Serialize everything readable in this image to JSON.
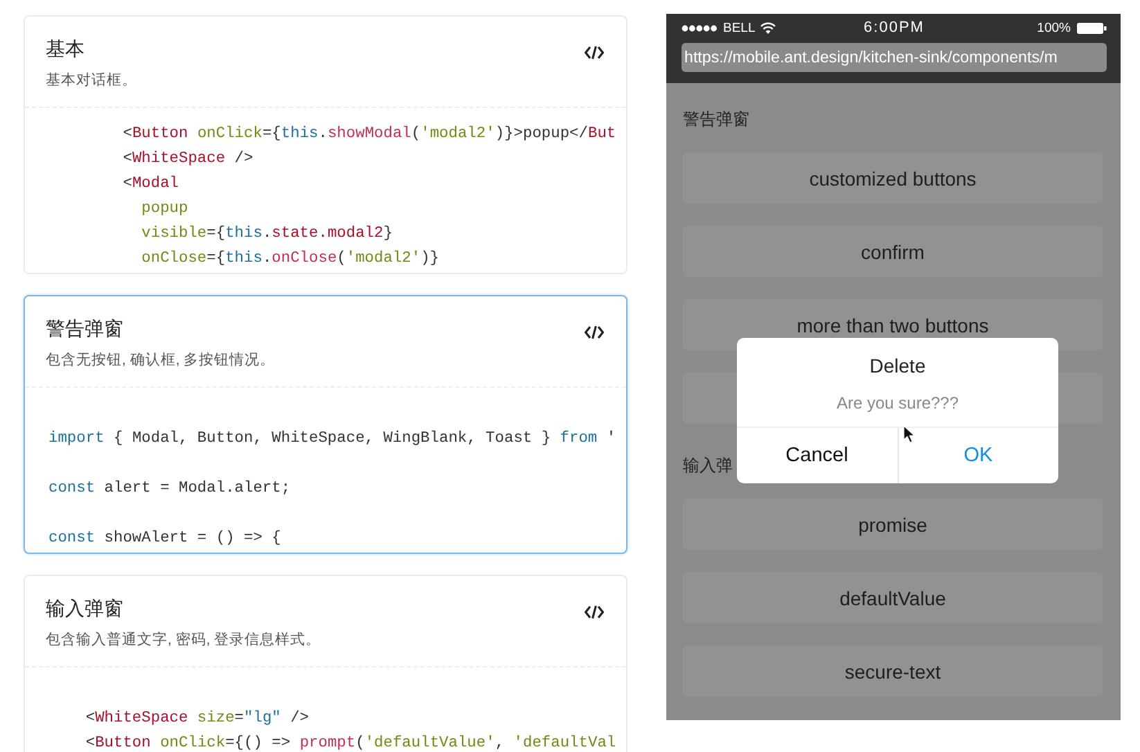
{
  "demo_cards": [
    {
      "title": "基本",
      "description": "基本对话框。",
      "selected": false,
      "code_lines": [
        {
          "kind": "code",
          "tokens": [
            {
              "kind": "punct",
              "text": "        <"
            },
            {
              "kind": "tag",
              "text": "Button"
            },
            {
              "kind": "attr",
              "text": " onClick"
            },
            {
              "kind": "punct",
              "text": "={"
            },
            {
              "kind": "keyword",
              "text": "this"
            },
            {
              "kind": "punct",
              "text": "."
            },
            {
              "kind": "func",
              "text": "showModal"
            },
            {
              "kind": "punct",
              "text": "("
            },
            {
              "kind": "string",
              "text": "'modal2'"
            },
            {
              "kind": "punct",
              "text": ")}>popup</"
            },
            {
              "kind": "tag",
              "text": "But"
            }
          ]
        },
        {
          "kind": "code",
          "tokens": [
            {
              "kind": "punct",
              "text": "        <"
            },
            {
              "kind": "tag",
              "text": "WhiteSpace"
            },
            {
              "kind": "punct",
              "text": " />"
            }
          ]
        },
        {
          "kind": "code",
          "tokens": [
            {
              "kind": "punct",
              "text": "        <"
            },
            {
              "kind": "tag",
              "text": "Modal"
            }
          ]
        },
        {
          "kind": "code",
          "tokens": [
            {
              "kind": "attr",
              "text": "          popup"
            }
          ]
        },
        {
          "kind": "code",
          "tokens": [
            {
              "kind": "attr",
              "text": "          visible"
            },
            {
              "kind": "punct",
              "text": "={"
            },
            {
              "kind": "keyword",
              "text": "this"
            },
            {
              "kind": "punct",
              "text": "."
            },
            {
              "kind": "prop",
              "text": "state.modal2"
            },
            {
              "kind": "punct",
              "text": "}"
            }
          ]
        },
        {
          "kind": "code",
          "tokens": [
            {
              "kind": "attr",
              "text": "          onClose"
            },
            {
              "kind": "punct",
              "text": "={"
            },
            {
              "kind": "keyword",
              "text": "this"
            },
            {
              "kind": "punct",
              "text": "."
            },
            {
              "kind": "func",
              "text": "onClose"
            },
            {
              "kind": "punct",
              "text": "("
            },
            {
              "kind": "string",
              "text": "'modal2'"
            },
            {
              "kind": "punct",
              "text": ")}"
            }
          ]
        }
      ]
    },
    {
      "title": "警告弹窗",
      "description": "包含无按钮, 确认框, 多按钮情况。",
      "selected": true,
      "code_lines": [
        {
          "kind": "blank"
        },
        {
          "kind": "code",
          "tokens": [
            {
              "kind": "keyword",
              "text": "import"
            },
            {
              "kind": "punct",
              "text": " { Modal, Button, WhiteSpace, WingBlank, Toast } "
            },
            {
              "kind": "keyword",
              "text": "from"
            },
            {
              "kind": "punct",
              "text": " '"
            }
          ]
        },
        {
          "kind": "blank"
        },
        {
          "kind": "code",
          "tokens": [
            {
              "kind": "keyword",
              "text": "const"
            },
            {
              "kind": "punct",
              "text": " alert = Modal.alert;"
            }
          ]
        },
        {
          "kind": "blank"
        },
        {
          "kind": "code",
          "tokens": [
            {
              "kind": "keyword",
              "text": "const"
            },
            {
              "kind": "punct",
              "text": " showAlert = () => {"
            }
          ]
        }
      ]
    },
    {
      "title": "输入弹窗",
      "description": "包含输入普通文字, 密码, 登录信息样式。",
      "selected": false,
      "code_lines": [
        {
          "kind": "blank"
        },
        {
          "kind": "code",
          "tokens": [
            {
              "kind": "punct",
              "text": "    <"
            },
            {
              "kind": "tag",
              "text": "WhiteSpace"
            },
            {
              "kind": "attr",
              "text": " size"
            },
            {
              "kind": "punct",
              "text": "="
            },
            {
              "kind": "keyword",
              "text": "\"lg\""
            },
            {
              "kind": "punct",
              "text": " />"
            }
          ]
        },
        {
          "kind": "code",
          "tokens": [
            {
              "kind": "punct",
              "text": "    <"
            },
            {
              "kind": "tag",
              "text": "Button"
            },
            {
              "kind": "attr",
              "text": " onClick"
            },
            {
              "kind": "punct",
              "text": "={() => "
            },
            {
              "kind": "func",
              "text": "prompt"
            },
            {
              "kind": "punct",
              "text": "("
            },
            {
              "kind": "string",
              "text": "'defaultValue'"
            },
            {
              "kind": "punct",
              "text": ", "
            },
            {
              "kind": "string",
              "text": "'defaultVal"
            }
          ]
        }
      ]
    }
  ],
  "phone": {
    "status_bar": {
      "carrier": "BELL",
      "time": "6:00PM",
      "battery": "100%"
    },
    "url": "https://mobile.ant.design/kitchen-sink/components/m",
    "sections": [
      {
        "title": "警告弹窗",
        "buttons": [
          {
            "kind": "labeled",
            "label": "customized buttons"
          },
          {
            "kind": "labeled",
            "label": "confirm"
          },
          {
            "kind": "labeled",
            "label": "more than two buttons"
          },
          {
            "kind": "covered"
          }
        ]
      },
      {
        "title": "输入弹",
        "buttons": [
          {
            "kind": "labeled",
            "label": "promise"
          },
          {
            "kind": "labeled",
            "label": "defaultValue"
          },
          {
            "kind": "labeled",
            "label": "secure-text"
          }
        ]
      }
    ],
    "alert_dialog": {
      "title": "Delete",
      "message": "Are you sure???",
      "actions": [
        {
          "label": "Cancel",
          "kind": "default"
        },
        {
          "label": "OK",
          "kind": "primary"
        }
      ]
    }
  }
}
